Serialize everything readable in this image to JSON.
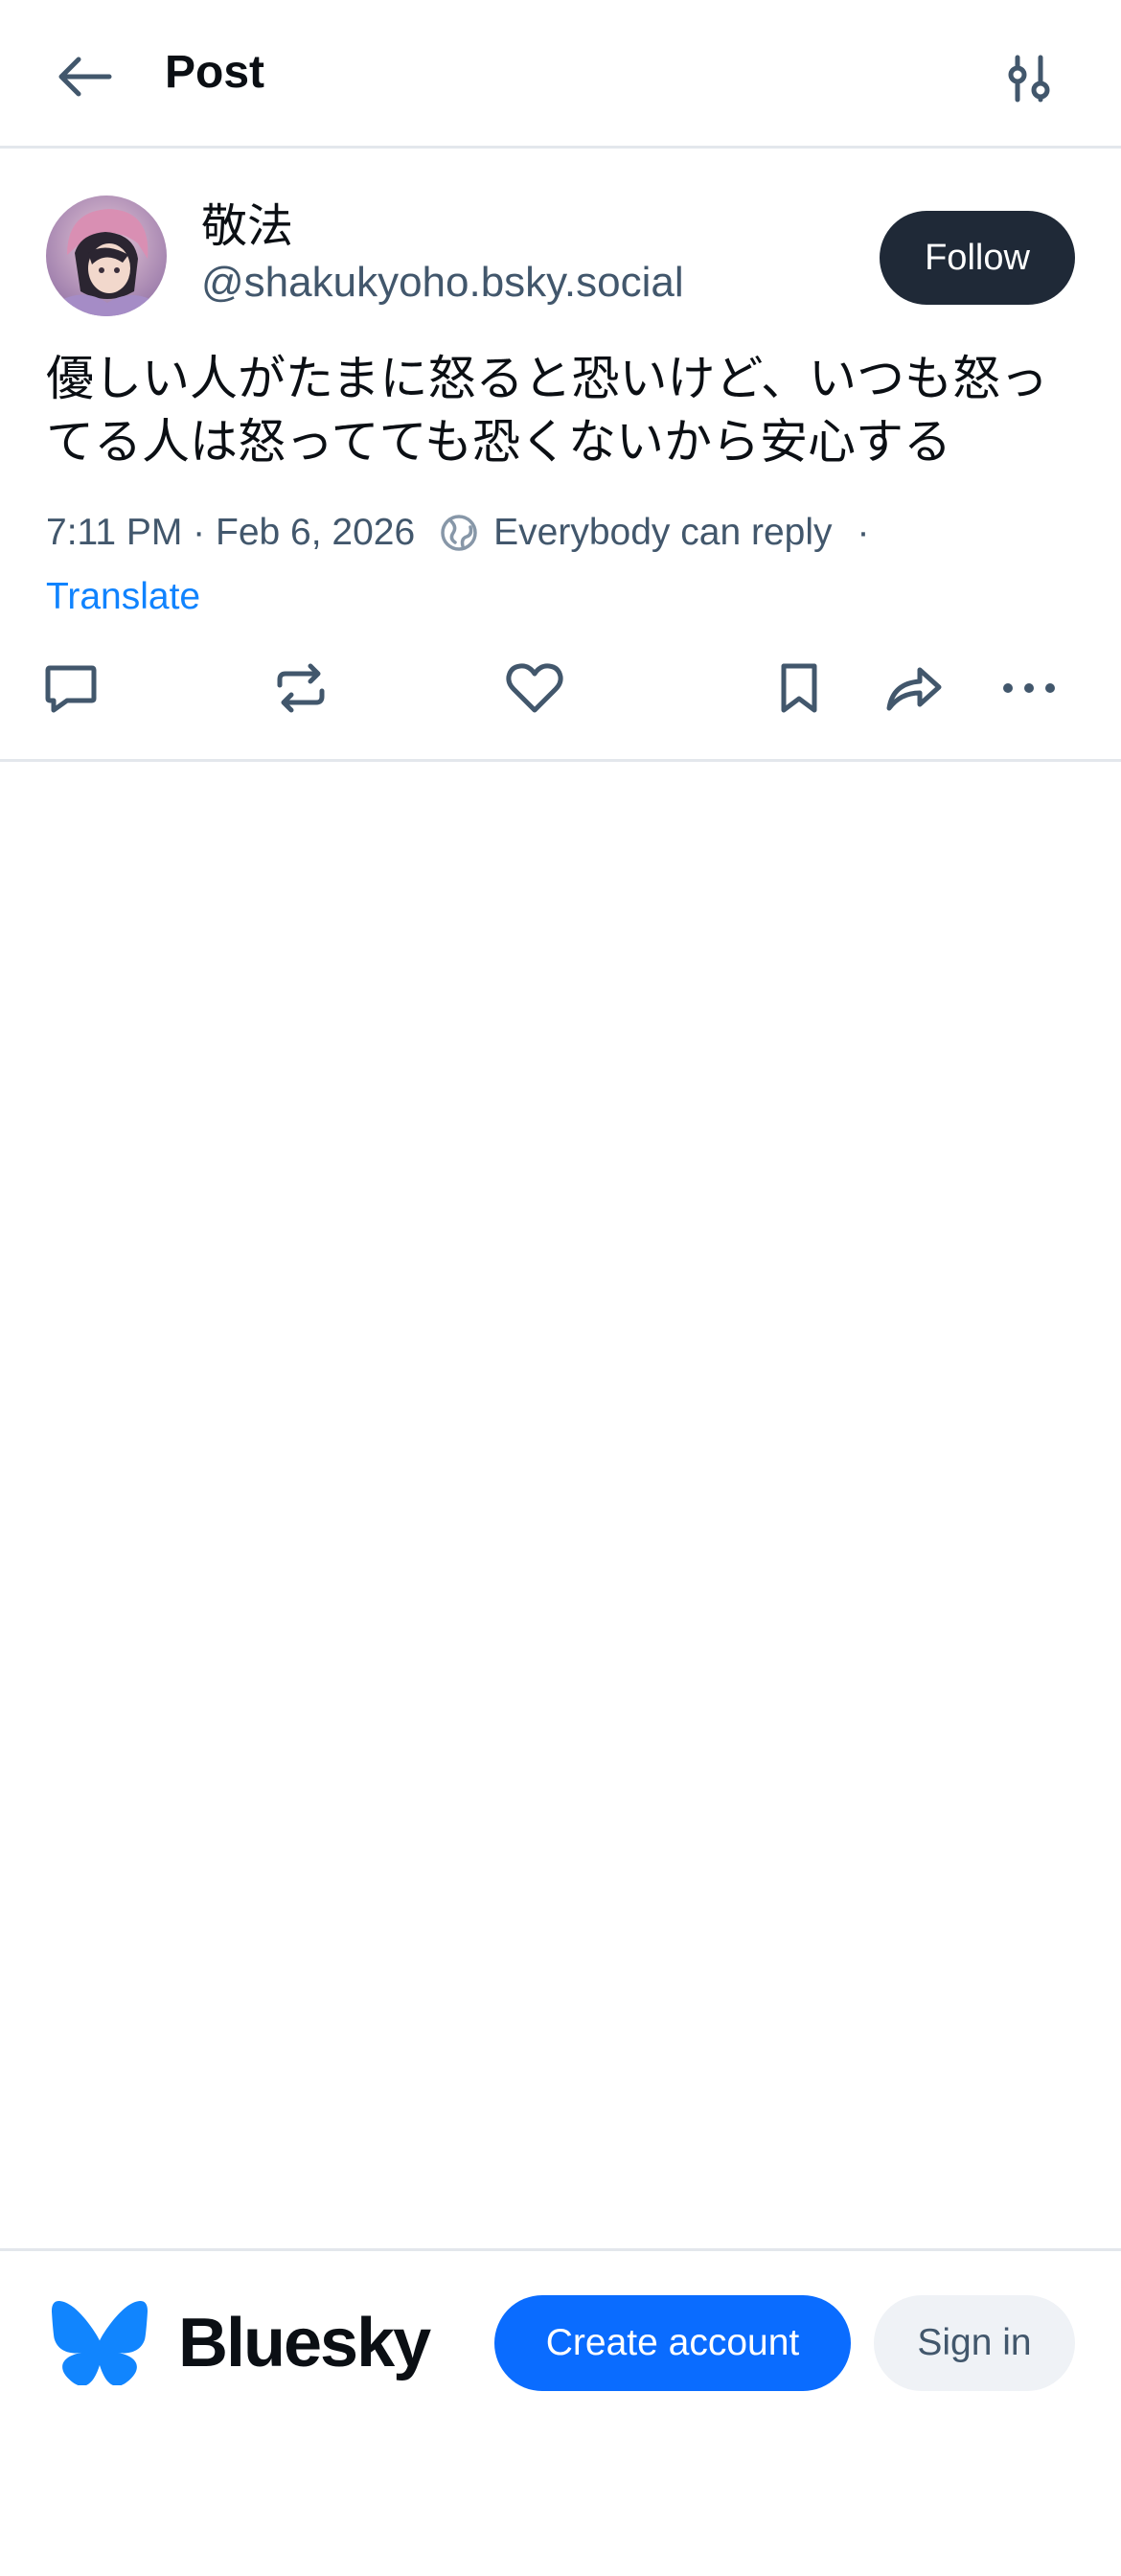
{
  "header": {
    "title": "Post",
    "back_icon": "arrow-left-icon",
    "settings_icon": "sliders-icon"
  },
  "post": {
    "author": {
      "display_name": "敬法",
      "handle": "@shakukyoho.bsky.social"
    },
    "follow_label": "Follow",
    "text": "優しい人がたまに怒ると恐いけど、いつも怒ってる人は怒ってても恐くないから安心する",
    "timestamp": "7:11 PM · Feb 6, 2026",
    "reply_setting": "Everybody can reply",
    "separator": "·",
    "translate_label": "Translate",
    "actions": [
      "reply-icon",
      "repost-icon",
      "like-icon",
      "bookmark-icon",
      "share-icon",
      "more-icon"
    ]
  },
  "bottom_bar": {
    "brand": "Bluesky",
    "create_account_label": "Create account",
    "sign_in_label": "Sign in"
  },
  "colors": {
    "link": "#1083fe",
    "primary": "#0a6cff",
    "follow_bg": "#1f2937",
    "muted": "#42576c",
    "divider": "#e3e7ec"
  }
}
